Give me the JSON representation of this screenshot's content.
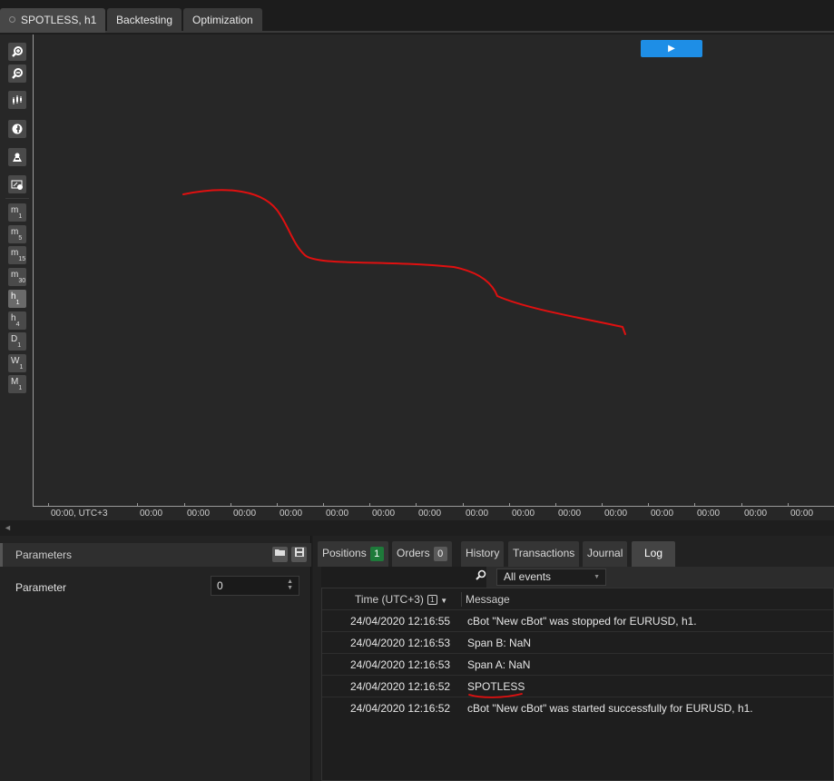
{
  "top_tabs": [
    "SPOTLESS, h1",
    "Backtesting",
    "Optimization"
  ],
  "chart": {
    "play_label": "▶",
    "toolbar_icons": [
      "zoom-in-icon",
      "zoom-out-icon",
      "chart-type-icon",
      "objects-icon",
      "cbot-icon",
      "screenshot-icon"
    ],
    "timeframes": [
      {
        "main": "m",
        "sub": "1"
      },
      {
        "main": "m",
        "sub": "5"
      },
      {
        "main": "m",
        "sub": "15"
      },
      {
        "main": "m",
        "sub": "30"
      },
      {
        "main": "h",
        "sub": "1"
      },
      {
        "main": "h",
        "sub": "4"
      },
      {
        "main": "D",
        "sub": "1"
      },
      {
        "main": "W",
        "sub": "1"
      },
      {
        "main": "M",
        "sub": "1"
      }
    ],
    "selected_timeframe": "h1",
    "x_ticks": [
      "00:00, UTC+3",
      "00:00",
      "00:00",
      "00:00",
      "00:00",
      "00:00",
      "00:00",
      "00:00",
      "00:00",
      "00:00",
      "00:00",
      "00:00",
      "00:00",
      "00:00",
      "00:00",
      "00:00",
      "00:00"
    ],
    "annotation_color": "#e01010"
  },
  "parameters": {
    "title": "Parameters",
    "label": "Parameter",
    "value": "0"
  },
  "bottom_tabs": [
    {
      "label": "Positions",
      "badge": "1"
    },
    {
      "label": "Orders",
      "badge": "0"
    },
    {
      "label": "History",
      "badge": ""
    },
    {
      "label": "Transactions",
      "badge": ""
    },
    {
      "label": "Journal",
      "badge": ""
    },
    {
      "label": "Log",
      "badge": ""
    }
  ],
  "active_bottom_tab": "Log",
  "filter": {
    "selected": "All events"
  },
  "log": {
    "headers": {
      "time": "Time (UTC+3)",
      "sort_badge": "1",
      "message": "Message"
    },
    "rows": [
      {
        "time": "24/04/2020 12:16:55",
        "message": "cBot \"New cBot\" was stopped for EURUSD, h1."
      },
      {
        "time": "24/04/2020 12:16:53",
        "message": "Span B: NaN"
      },
      {
        "time": "24/04/2020 12:16:53",
        "message": "Span A: NaN"
      },
      {
        "time": "24/04/2020 12:16:52",
        "message": "SPOTLESS"
      },
      {
        "time": "24/04/2020 12:16:52",
        "message": "cBot \"New cBot\" was started successfully for EURUSD, h1."
      }
    ]
  }
}
